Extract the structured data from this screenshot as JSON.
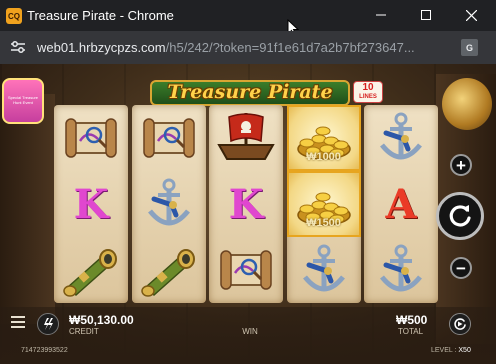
{
  "window": {
    "title": "Treasure Pirate - Chrome",
    "app_icon_text": "CQ",
    "controls": {
      "minimize": "minimize",
      "maximize": "maximize",
      "close": "close"
    }
  },
  "address_bar": {
    "host": "web01.hrbzycpzs.com",
    "path": "/h5/242/?token=91f1e61d7a2b7bf273647..."
  },
  "game": {
    "logo": "Treasure Pirate",
    "lines": {
      "number": "10",
      "label": "LINES"
    },
    "promo_badge": "Special Treasure Hunt Event",
    "reels": [
      [
        {
          "symbol": "map-scroll"
        },
        {
          "symbol": "K"
        },
        {
          "symbol": "spyglass"
        }
      ],
      [
        {
          "symbol": "map-scroll"
        },
        {
          "symbol": "anchor"
        },
        {
          "symbol": "spyglass"
        }
      ],
      [
        {
          "symbol": "pirate-ship"
        },
        {
          "symbol": "K"
        },
        {
          "symbol": "map-scroll"
        }
      ],
      [
        {
          "symbol": "gold-coins",
          "win": true,
          "value": "₩1000"
        },
        {
          "symbol": "gold-coins",
          "win": true,
          "value": "₩1500"
        },
        {
          "symbol": "anchor"
        }
      ],
      [
        {
          "symbol": "anchor"
        },
        {
          "symbol": "A"
        },
        {
          "symbol": "anchor"
        }
      ]
    ],
    "controls": {
      "plus": "+",
      "minus": "−"
    },
    "bottom_bar": {
      "credit_value": "₩50,130.00",
      "credit_label": "CREDIT",
      "win_label": "WIN",
      "total_value": "₩500",
      "total_label": "TOTAL",
      "session_id": "714723993522",
      "level_label": "LEVEL :",
      "level_value": "X50"
    }
  },
  "colors": {
    "accent_gold": "#ffd24a",
    "symbol_K": "#e047cf",
    "symbol_A": "#ea3b27",
    "reel_paper": "#efe1c4"
  }
}
